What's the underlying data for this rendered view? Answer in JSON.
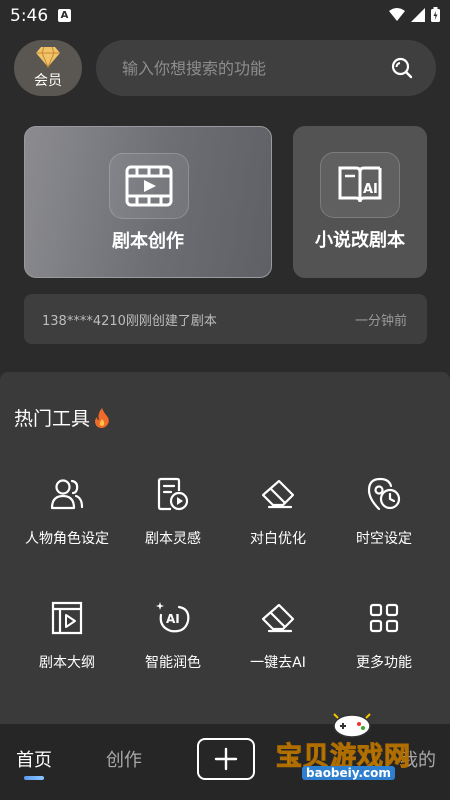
{
  "status": {
    "time": "5:46",
    "app_badge": "A"
  },
  "vip": {
    "label": "会员",
    "icon": "diamond-icon"
  },
  "search": {
    "placeholder": "输入你想搜索的功能",
    "icon": "search-icon"
  },
  "cards": {
    "main": {
      "title": "剧本创作",
      "icon": "film-icon"
    },
    "side": {
      "title": "小说改剧本",
      "icon": "ai-book-icon"
    }
  },
  "notice": {
    "text": "138****4210刚刚创建了剧本",
    "time": "一分钟前"
  },
  "tools": {
    "heading": "热门工具",
    "heading_icon": "fire-icon",
    "items": [
      {
        "label": "人物角色设定",
        "icon": "people-icon"
      },
      {
        "label": "剧本灵感",
        "icon": "script-play-icon"
      },
      {
        "label": "对白优化",
        "icon": "eraser-icon"
      },
      {
        "label": "时空设定",
        "icon": "location-clock-icon"
      },
      {
        "label": "剧本大纲",
        "icon": "outline-icon"
      },
      {
        "label": "智能润色",
        "icon": "ai-sparkle-icon"
      },
      {
        "label": "一键去AI",
        "icon": "eraser-icon"
      },
      {
        "label": "更多功能",
        "icon": "grid-icon"
      }
    ]
  },
  "nav": {
    "home": "首页",
    "create": "创作",
    "mine": "我的",
    "add_icon": "plus-icon"
  },
  "watermark": {
    "text": "宝贝游戏网",
    "url": "baobeiy.com"
  },
  "colors": {
    "background": "#2b2b2b",
    "panel": "#3a3a3a",
    "accent": "#5b9bf0",
    "watermark": "#f5c400"
  }
}
